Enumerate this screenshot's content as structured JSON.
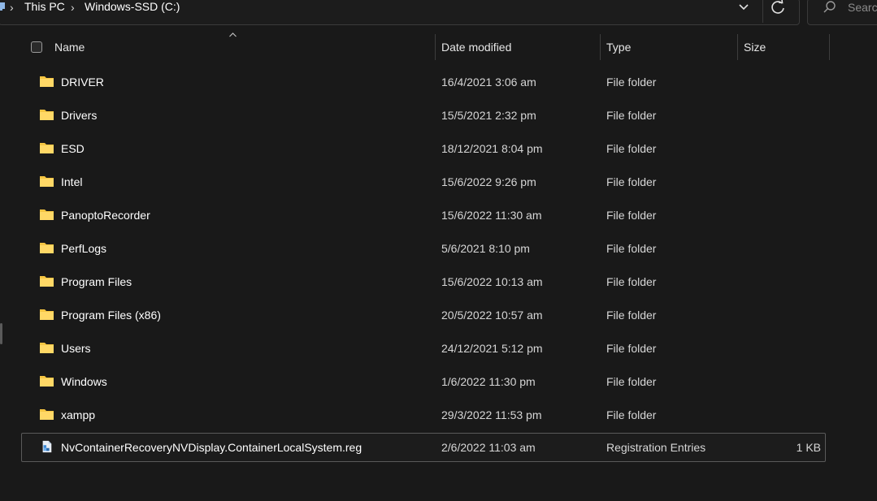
{
  "address_bar": {
    "breadcrumbs": [
      "This PC",
      "Windows-SSD (C:)"
    ],
    "search_placeholder": "Search"
  },
  "columns": {
    "name": "Name",
    "date": "Date modified",
    "type": "Type",
    "size": "Size"
  },
  "sort": {
    "column": "Name",
    "direction": "ascending"
  },
  "files": [
    {
      "name": "DRIVER",
      "date": "16/4/2021 3:06 am",
      "type": "File folder",
      "size": "",
      "icon": "folder-icon"
    },
    {
      "name": "Drivers",
      "date": "15/5/2021 2:32 pm",
      "type": "File folder",
      "size": "",
      "icon": "folder-icon"
    },
    {
      "name": "ESD",
      "date": "18/12/2021 8:04 pm",
      "type": "File folder",
      "size": "",
      "icon": "folder-icon"
    },
    {
      "name": "Intel",
      "date": "15/6/2022 9:26 pm",
      "type": "File folder",
      "size": "",
      "icon": "folder-icon"
    },
    {
      "name": "PanoptoRecorder",
      "date": "15/6/2022 11:30 am",
      "type": "File folder",
      "size": "",
      "icon": "folder-icon"
    },
    {
      "name": "PerfLogs",
      "date": "5/6/2021 8:10 pm",
      "type": "File folder",
      "size": "",
      "icon": "folder-icon"
    },
    {
      "name": "Program Files",
      "date": "15/6/2022 10:13 am",
      "type": "File folder",
      "size": "",
      "icon": "folder-icon"
    },
    {
      "name": "Program Files (x86)",
      "date": "20/5/2022 10:57 am",
      "type": "File folder",
      "size": "",
      "icon": "folder-icon"
    },
    {
      "name": "Users",
      "date": "24/12/2021 5:12 pm",
      "type": "File folder",
      "size": "",
      "icon": "folder-icon"
    },
    {
      "name": "Windows",
      "date": "1/6/2022 11:30 pm",
      "type": "File folder",
      "size": "",
      "icon": "folder-icon"
    },
    {
      "name": "xampp",
      "date": "29/3/2022 11:53 pm",
      "type": "File folder",
      "size": "",
      "icon": "folder-icon"
    },
    {
      "name": "NvContainerRecoveryNVDisplay.ContainerLocalSystem.reg",
      "date": "2/6/2022 11:03 am",
      "type": "Registration Entries",
      "size": "1 KB",
      "icon": "registry-file-icon",
      "selected": true
    }
  ],
  "colors": {
    "background": "#191919",
    "folder": "#f5c542",
    "border": "#3a3a3a"
  }
}
